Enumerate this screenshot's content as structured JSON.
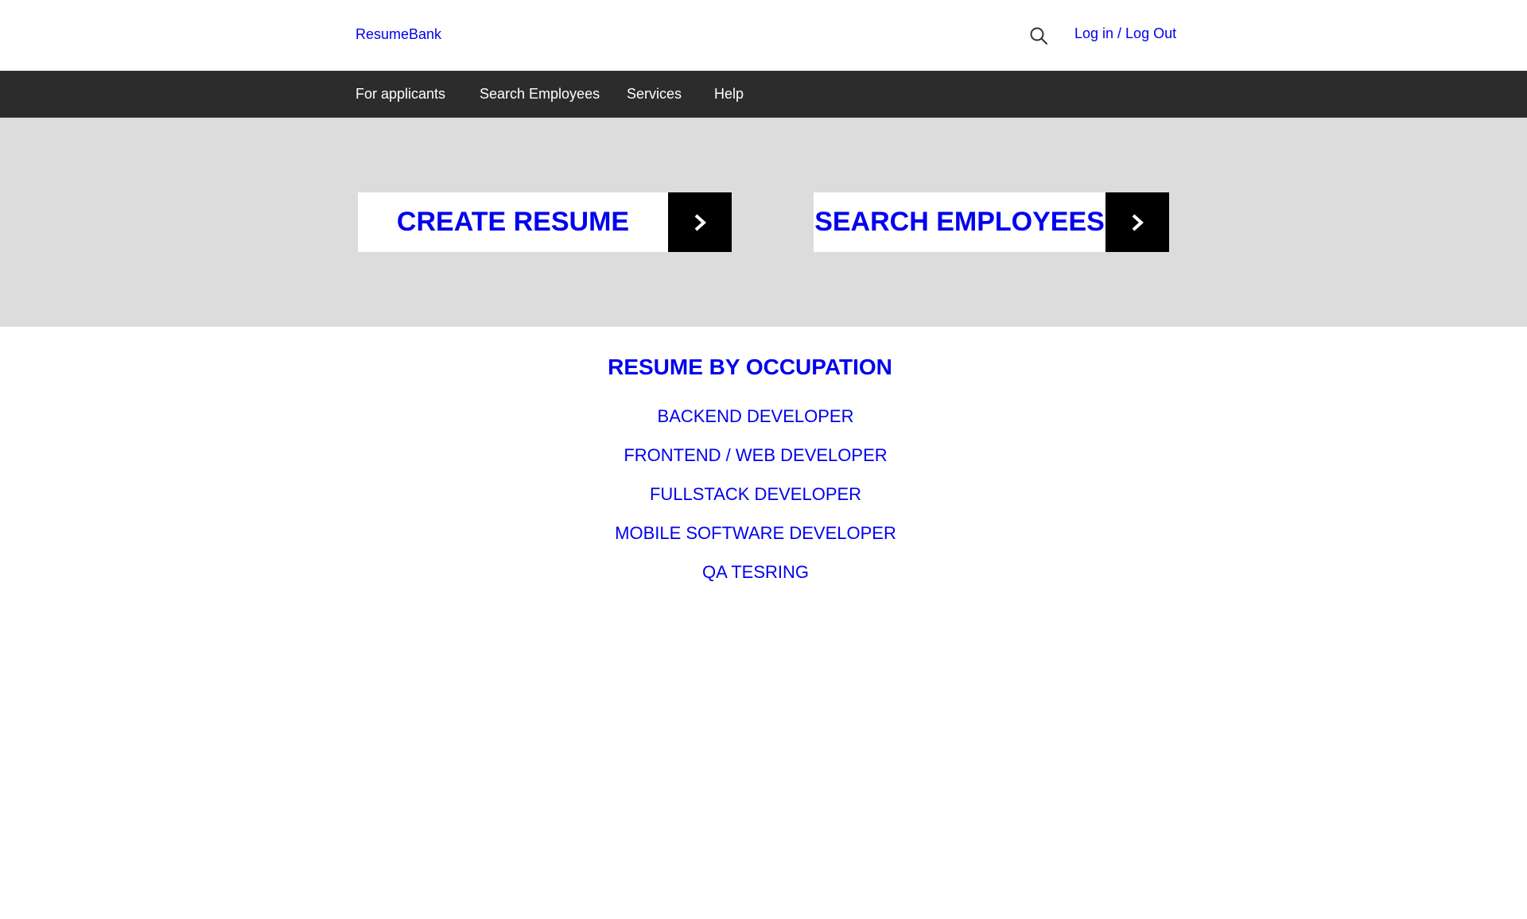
{
  "header": {
    "brand": "ResumeBank",
    "search_icon": "search-icon",
    "auth_label": "Log in / Log Out"
  },
  "nav": {
    "items": [
      {
        "label": "For applicants"
      },
      {
        "label": "Search Employees"
      },
      {
        "label": "Services"
      },
      {
        "label": "Help"
      }
    ]
  },
  "hero": {
    "create_resume": {
      "label": "CREATE RESUME",
      "icon": "chevron-right-icon"
    },
    "search_employees": {
      "label": "SEARCH EMPLOYEES",
      "icon": "chevron-right-icon"
    }
  },
  "occupations": {
    "title": "RESUME BY OCCUPATION",
    "items": [
      {
        "label": "BACKEND DEVELOPER"
      },
      {
        "label": "FRONTEND / WEB DEVELOPER"
      },
      {
        "label": "FULLSTACK DEVELOPER"
      },
      {
        "label": "MOBILE SOFTWARE DEVELOPER"
      },
      {
        "label": "QA TESRING"
      }
    ]
  },
  "colors": {
    "link": "#0000ee",
    "navbar_bg": "#2c2c2c",
    "hero_bg": "#dcdcdc",
    "arrow_bg": "#000000"
  }
}
